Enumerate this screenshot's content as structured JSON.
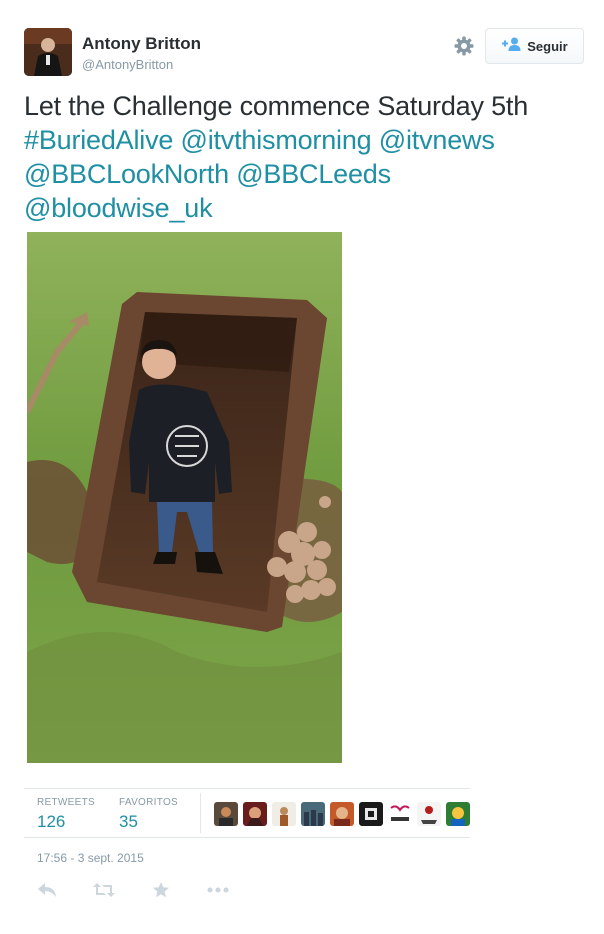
{
  "author": {
    "name": "Antony Britton",
    "handle": "@AntonyBritton"
  },
  "follow_button": {
    "label": "Seguir"
  },
  "tweet": {
    "text": "Let the Challenge commence Saturday 5th ",
    "hashtag": "#BuriedAlive",
    "mentions": [
      "@itvthismorning",
      "@itvnews",
      "@BBCLookNorth",
      "@BBCLeeds",
      "@bloodwise_uk"
    ]
  },
  "stats": {
    "retweets_label": "RETWEETS",
    "retweets_count": "126",
    "favorites_label": "FAVORITOS",
    "favorites_count": "35"
  },
  "favoriter_avatar_count": 9,
  "timestamp": "17:56 - 3 sept. 2015",
  "colors": {
    "link": "#1f8fa4",
    "muted": "#8899a6",
    "text": "#292f33"
  }
}
